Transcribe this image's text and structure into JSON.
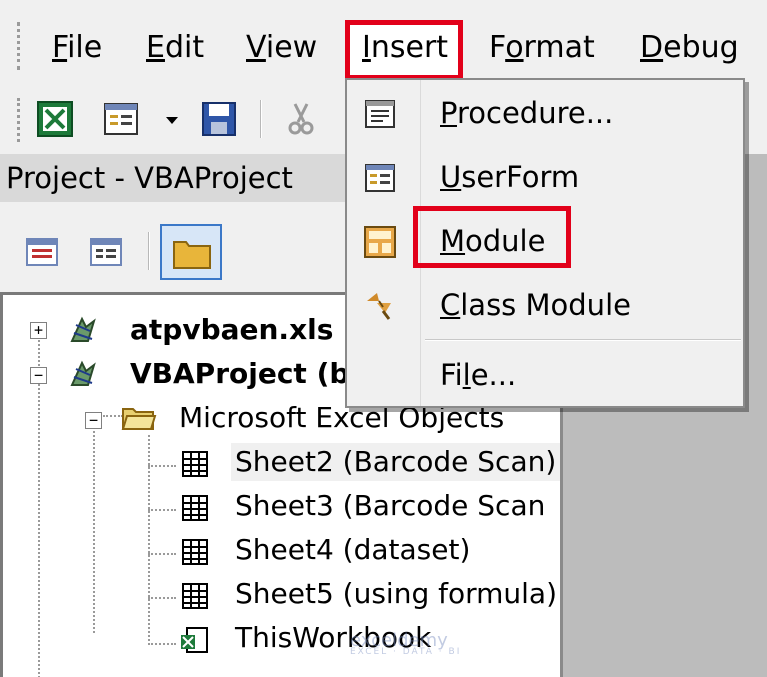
{
  "menubar": {
    "items": [
      {
        "pre": "",
        "u": "F",
        "post": "ile"
      },
      {
        "pre": "",
        "u": "E",
        "post": "dit"
      },
      {
        "pre": "",
        "u": "V",
        "post": "iew"
      },
      {
        "pre": "",
        "u": "I",
        "post": "nsert"
      },
      {
        "pre": "F",
        "u": "o",
        "post": "rmat"
      },
      {
        "pre": "",
        "u": "D",
        "post": "ebug"
      }
    ]
  },
  "toolbar": {
    "icons": [
      "excel-icon",
      "insert-userform-icon",
      "dropdown-arrow-icon",
      "save-icon",
      "cut-icon"
    ]
  },
  "project": {
    "title": "Project - VBAProject",
    "tree": [
      {
        "label": "atpvbaen.xls",
        "bold": true
      },
      {
        "label": "VBAProject (b",
        "bold": true
      },
      {
        "label": "Microsoft Excel Objects",
        "bold": false
      },
      {
        "label": "Sheet2 (Barcode Scan)",
        "bold": false
      },
      {
        "label": "Sheet3 (Barcode Scan",
        "bold": false
      },
      {
        "label": "Sheet4 (dataset)",
        "bold": false
      },
      {
        "label": "Sheet5 (using formula)",
        "bold": false
      },
      {
        "label": "ThisWorkbook",
        "bold": false
      }
    ]
  },
  "insert_menu": {
    "items": [
      {
        "pre": "",
        "u": "P",
        "post": "rocedure..."
      },
      {
        "pre": "",
        "u": "U",
        "post": "serForm"
      },
      {
        "pre": "",
        "u": "M",
        "post": "odule"
      },
      {
        "pre": "",
        "u": "C",
        "post": "lass Module"
      },
      {
        "pre": "Fi",
        "u": "l",
        "post": "e..."
      }
    ]
  },
  "colors": {
    "highlight": "#e2001a",
    "excel_green": "#1d7a3a"
  },
  "watermark": {
    "brand": "exceldemy",
    "tagline": "EXCEL · DATA · BI"
  }
}
